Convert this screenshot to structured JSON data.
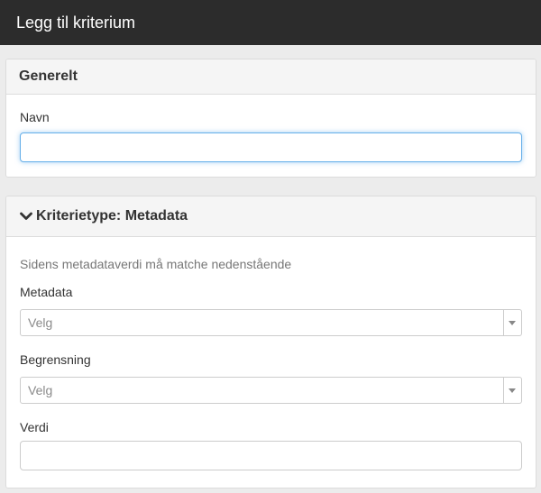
{
  "window": {
    "title": "Legg til kriterium"
  },
  "general": {
    "heading": "Generelt",
    "name_label": "Navn",
    "name_value": ""
  },
  "criteria": {
    "heading": "Kriterietype: Metadata",
    "heading_icon": "chevron-down-icon",
    "help_text": "Sidens metadataverdi må matche nedenstående",
    "metadata_label": "Metadata",
    "metadata_placeholder": "Velg",
    "restriction_label": "Begrensning",
    "restriction_placeholder": "Velg",
    "value_label": "Verdi",
    "value_value": ""
  },
  "colors": {
    "titlebar_bg": "#2c2c2c",
    "focus_border": "#66afe9",
    "panel_heading_bg": "#f5f5f5"
  }
}
